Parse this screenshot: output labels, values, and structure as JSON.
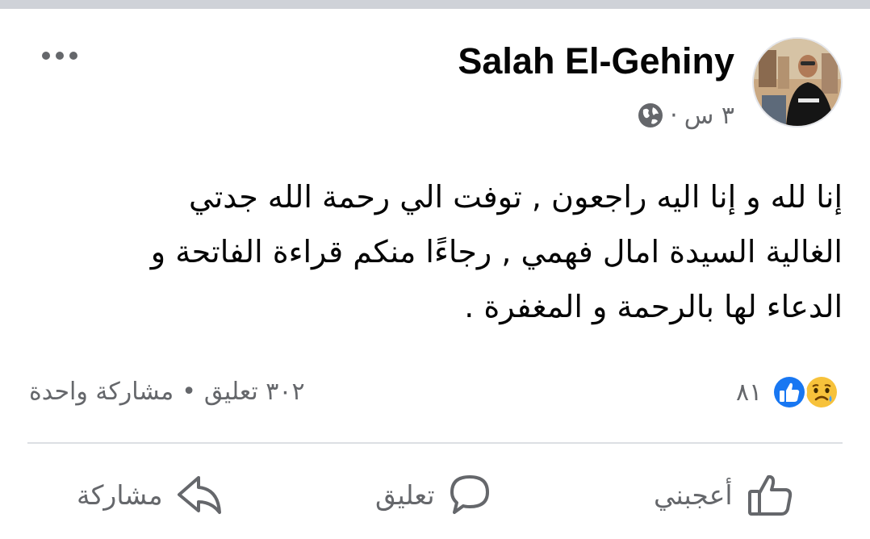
{
  "post": {
    "author": "Salah El-Gehiny",
    "time": "٣ س",
    "separator": "·",
    "privacy_icon": "globe-icon",
    "text": "إنا لله و إنا اليه راجعون , توفت الي رحمة الله جدتي\nالغالية السيدة امال فهمي , رجاءًا منكم قراءة الفاتحة و\nالدعاء لها بالرحمة و المغفرة ."
  },
  "reactions": {
    "count": "٨١",
    "icons": [
      "sad-reaction-icon",
      "like-reaction-icon"
    ]
  },
  "stats": {
    "comments": "٣٠٢ تعليق",
    "bullet": "•",
    "shares": "مشاركة واحدة"
  },
  "actions": {
    "like": "أعجبني",
    "comment": "تعليق",
    "share": "مشاركة"
  },
  "colors": {
    "text_primary": "#050505",
    "text_secondary": "#65676b",
    "like_blue": "#1877f2",
    "sad_yellow": "#f7c23b",
    "divider": "#dcdfe3"
  }
}
